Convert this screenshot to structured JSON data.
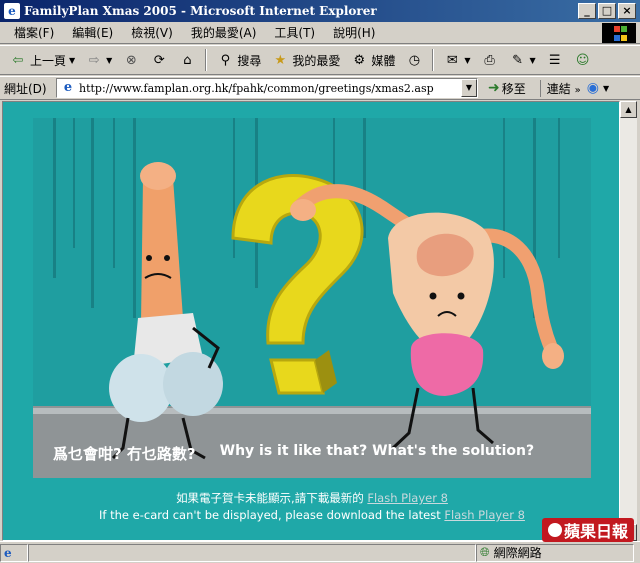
{
  "window": {
    "title": "FamilyPlan Xmas 2005 - Microsoft Internet Explorer",
    "controls": [
      "_",
      "□",
      "×"
    ]
  },
  "menu": {
    "items": [
      "檔案(F)",
      "編輯(E)",
      "檢視(V)",
      "我的最愛(A)",
      "工具(T)",
      "說明(H)"
    ]
  },
  "toolbar": {
    "back_label": "上一頁",
    "search_label": "搜尋",
    "favorites_label": "我的最愛",
    "media_label": "媒體"
  },
  "address": {
    "label": "網址(D)",
    "value": "http://www.famplan.org.hk/fpahk/common/greetings/xmas2.asp",
    "go_label": "移至",
    "links_label": "連結"
  },
  "ecard": {
    "caption_zh": "爲乜會咁? 冇乜路數?",
    "caption_en": "Why is it like that? What's the solution?",
    "colors": {
      "background": "#1f9ea0",
      "question_mark": "#e8d81c",
      "floor": "#9a9a9a"
    }
  },
  "notice": {
    "line1_text": "如果電子賀卡未能顯示,請下載最新的",
    "line1_link": "Flash Player 8",
    "line2_text": "If the e-card can't be displayed, please download the latest",
    "line2_link": "Flash Player 8"
  },
  "status": {
    "zone_label": "網際網路"
  },
  "watermark": {
    "text": "蘋果日報"
  }
}
